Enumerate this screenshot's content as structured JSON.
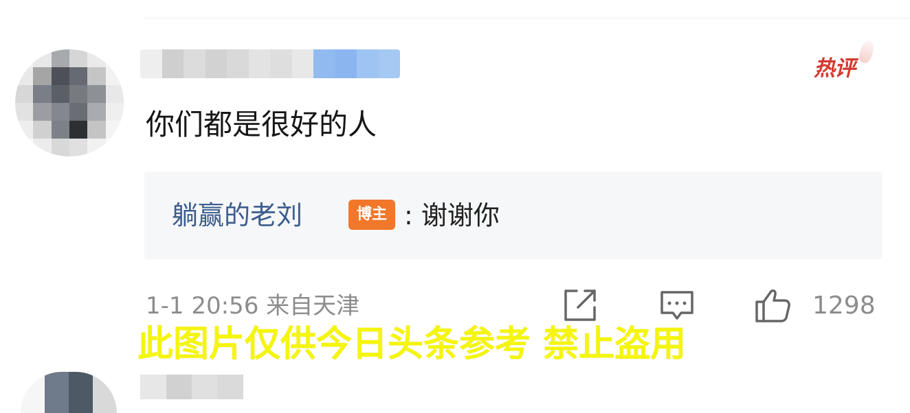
{
  "comment": {
    "text": "你们都是很好的人",
    "hot_badge": "热评",
    "reply": {
      "author": "躺赢的老刘",
      "author_badge": "博主",
      "separator": ":",
      "text": "谢谢你"
    },
    "meta": {
      "time_location": "1-1 20:56 来自天津"
    },
    "actions": {
      "share_icon": "share-icon",
      "reply_icon": "reply-icon",
      "like_icon": "thumbs-up-icon",
      "like_count": "1298"
    }
  },
  "watermark": {
    "text": "此图片仅供今日头条参考 禁止盗用"
  },
  "colors": {
    "author_name": "#3b5c8d",
    "blogger_badge": "#f1772a",
    "hot_badge": "#d43a2f",
    "meta_text": "#8c8c8c",
    "watermark": "#f5f50e",
    "reply_background": "#f6f7f8"
  }
}
